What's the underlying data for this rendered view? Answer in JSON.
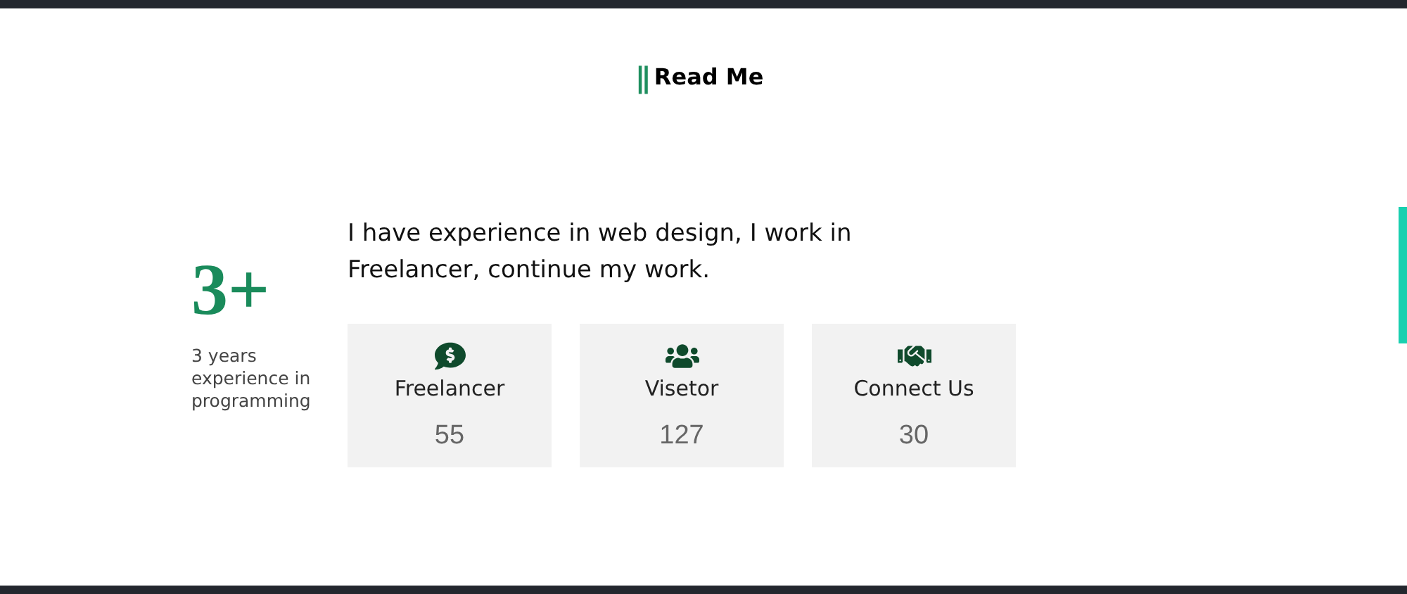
{
  "heading": {
    "marker": "||",
    "title": "Read Me"
  },
  "experience": {
    "value": "3+",
    "caption": "3 years experience in programming"
  },
  "intro": "I have experience in web design, I work in Freelancer, continue my work.",
  "stats": [
    {
      "kind": "money",
      "label": "Freelancer",
      "count": "55"
    },
    {
      "kind": "users",
      "label": "Visetor",
      "count": "127"
    },
    {
      "kind": "handshake",
      "label": "Connect Us",
      "count": "30"
    }
  ]
}
